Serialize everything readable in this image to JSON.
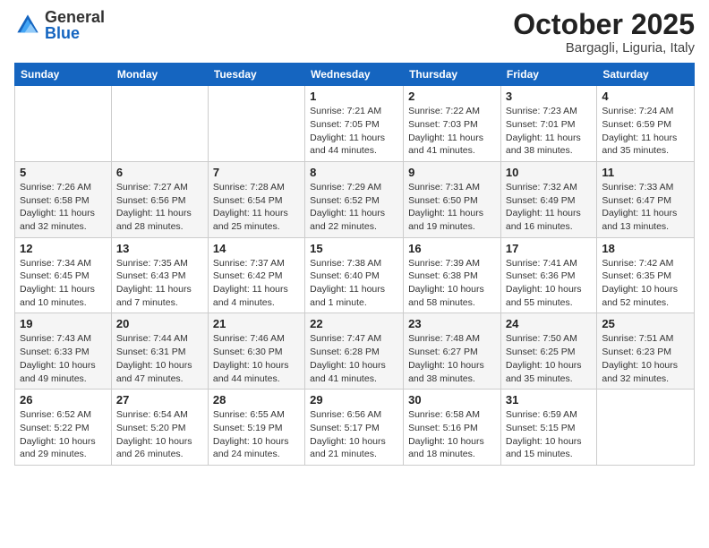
{
  "header": {
    "logo_general": "General",
    "logo_blue": "Blue",
    "month_title": "October 2025",
    "location": "Bargagli, Liguria, Italy"
  },
  "weekdays": [
    "Sunday",
    "Monday",
    "Tuesday",
    "Wednesday",
    "Thursday",
    "Friday",
    "Saturday"
  ],
  "weeks": [
    [
      {
        "day": "",
        "info": ""
      },
      {
        "day": "",
        "info": ""
      },
      {
        "day": "",
        "info": ""
      },
      {
        "day": "1",
        "info": "Sunrise: 7:21 AM\nSunset: 7:05 PM\nDaylight: 11 hours and 44 minutes."
      },
      {
        "day": "2",
        "info": "Sunrise: 7:22 AM\nSunset: 7:03 PM\nDaylight: 11 hours and 41 minutes."
      },
      {
        "day": "3",
        "info": "Sunrise: 7:23 AM\nSunset: 7:01 PM\nDaylight: 11 hours and 38 minutes."
      },
      {
        "day": "4",
        "info": "Sunrise: 7:24 AM\nSunset: 6:59 PM\nDaylight: 11 hours and 35 minutes."
      }
    ],
    [
      {
        "day": "5",
        "info": "Sunrise: 7:26 AM\nSunset: 6:58 PM\nDaylight: 11 hours and 32 minutes."
      },
      {
        "day": "6",
        "info": "Sunrise: 7:27 AM\nSunset: 6:56 PM\nDaylight: 11 hours and 28 minutes."
      },
      {
        "day": "7",
        "info": "Sunrise: 7:28 AM\nSunset: 6:54 PM\nDaylight: 11 hours and 25 minutes."
      },
      {
        "day": "8",
        "info": "Sunrise: 7:29 AM\nSunset: 6:52 PM\nDaylight: 11 hours and 22 minutes."
      },
      {
        "day": "9",
        "info": "Sunrise: 7:31 AM\nSunset: 6:50 PM\nDaylight: 11 hours and 19 minutes."
      },
      {
        "day": "10",
        "info": "Sunrise: 7:32 AM\nSunset: 6:49 PM\nDaylight: 11 hours and 16 minutes."
      },
      {
        "day": "11",
        "info": "Sunrise: 7:33 AM\nSunset: 6:47 PM\nDaylight: 11 hours and 13 minutes."
      }
    ],
    [
      {
        "day": "12",
        "info": "Sunrise: 7:34 AM\nSunset: 6:45 PM\nDaylight: 11 hours and 10 minutes."
      },
      {
        "day": "13",
        "info": "Sunrise: 7:35 AM\nSunset: 6:43 PM\nDaylight: 11 hours and 7 minutes."
      },
      {
        "day": "14",
        "info": "Sunrise: 7:37 AM\nSunset: 6:42 PM\nDaylight: 11 hours and 4 minutes."
      },
      {
        "day": "15",
        "info": "Sunrise: 7:38 AM\nSunset: 6:40 PM\nDaylight: 11 hours and 1 minute."
      },
      {
        "day": "16",
        "info": "Sunrise: 7:39 AM\nSunset: 6:38 PM\nDaylight: 10 hours and 58 minutes."
      },
      {
        "day": "17",
        "info": "Sunrise: 7:41 AM\nSunset: 6:36 PM\nDaylight: 10 hours and 55 minutes."
      },
      {
        "day": "18",
        "info": "Sunrise: 7:42 AM\nSunset: 6:35 PM\nDaylight: 10 hours and 52 minutes."
      }
    ],
    [
      {
        "day": "19",
        "info": "Sunrise: 7:43 AM\nSunset: 6:33 PM\nDaylight: 10 hours and 49 minutes."
      },
      {
        "day": "20",
        "info": "Sunrise: 7:44 AM\nSunset: 6:31 PM\nDaylight: 10 hours and 47 minutes."
      },
      {
        "day": "21",
        "info": "Sunrise: 7:46 AM\nSunset: 6:30 PM\nDaylight: 10 hours and 44 minutes."
      },
      {
        "day": "22",
        "info": "Sunrise: 7:47 AM\nSunset: 6:28 PM\nDaylight: 10 hours and 41 minutes."
      },
      {
        "day": "23",
        "info": "Sunrise: 7:48 AM\nSunset: 6:27 PM\nDaylight: 10 hours and 38 minutes."
      },
      {
        "day": "24",
        "info": "Sunrise: 7:50 AM\nSunset: 6:25 PM\nDaylight: 10 hours and 35 minutes."
      },
      {
        "day": "25",
        "info": "Sunrise: 7:51 AM\nSunset: 6:23 PM\nDaylight: 10 hours and 32 minutes."
      }
    ],
    [
      {
        "day": "26",
        "info": "Sunrise: 6:52 AM\nSunset: 5:22 PM\nDaylight: 10 hours and 29 minutes."
      },
      {
        "day": "27",
        "info": "Sunrise: 6:54 AM\nSunset: 5:20 PM\nDaylight: 10 hours and 26 minutes."
      },
      {
        "day": "28",
        "info": "Sunrise: 6:55 AM\nSunset: 5:19 PM\nDaylight: 10 hours and 24 minutes."
      },
      {
        "day": "29",
        "info": "Sunrise: 6:56 AM\nSunset: 5:17 PM\nDaylight: 10 hours and 21 minutes."
      },
      {
        "day": "30",
        "info": "Sunrise: 6:58 AM\nSunset: 5:16 PM\nDaylight: 10 hours and 18 minutes."
      },
      {
        "day": "31",
        "info": "Sunrise: 6:59 AM\nSunset: 5:15 PM\nDaylight: 10 hours and 15 minutes."
      },
      {
        "day": "",
        "info": ""
      }
    ]
  ]
}
